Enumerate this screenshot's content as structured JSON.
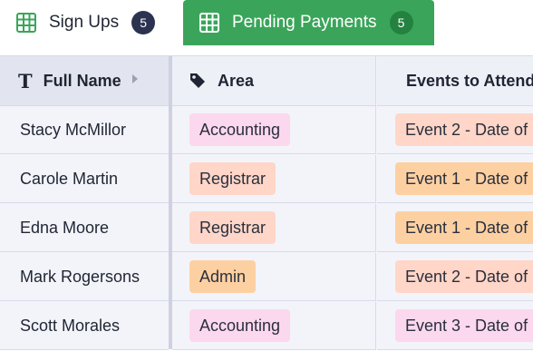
{
  "tabs": [
    {
      "label": "Sign Ups",
      "count": "5",
      "active": false
    },
    {
      "label": "Pending Payments",
      "count": "5",
      "active": true
    }
  ],
  "columns": {
    "name": {
      "label": "Full Name",
      "icon": "text-type-icon"
    },
    "area": {
      "label": "Area",
      "icon": "tag-icon"
    },
    "events": {
      "label": "Events to Attend",
      "icon": "tags-icon"
    }
  },
  "rows": [
    {
      "name": "Stacy McMillor",
      "area": "Accounting",
      "area_color": "#fcd8ee",
      "event": "Event 2 - Date of",
      "event_color": "#ffd6c8"
    },
    {
      "name": "Carole Martin",
      "area": "Registrar",
      "area_color": "#ffd6c8",
      "event": "Event 1 - Date of",
      "event_color": "#fdd0a2"
    },
    {
      "name": "Edna Moore",
      "area": "Registrar",
      "area_color": "#ffd6c8",
      "event": "Event 1 - Date of",
      "event_color": "#fdd0a2"
    },
    {
      "name": "Mark Rogersons",
      "area": "Admin",
      "area_color": "#fdd0a2",
      "event": "Event 2 - Date of",
      "event_color": "#ffd6c8"
    },
    {
      "name": "Scott Morales",
      "area": "Accounting",
      "area_color": "#fcd8ee",
      "event": "Event 3 - Date of",
      "event_color": "#fcd8ee"
    }
  ],
  "colors": {
    "active_tab": "#3aa55a",
    "badge_dark": "#2b3350",
    "badge_green": "#23823f"
  }
}
